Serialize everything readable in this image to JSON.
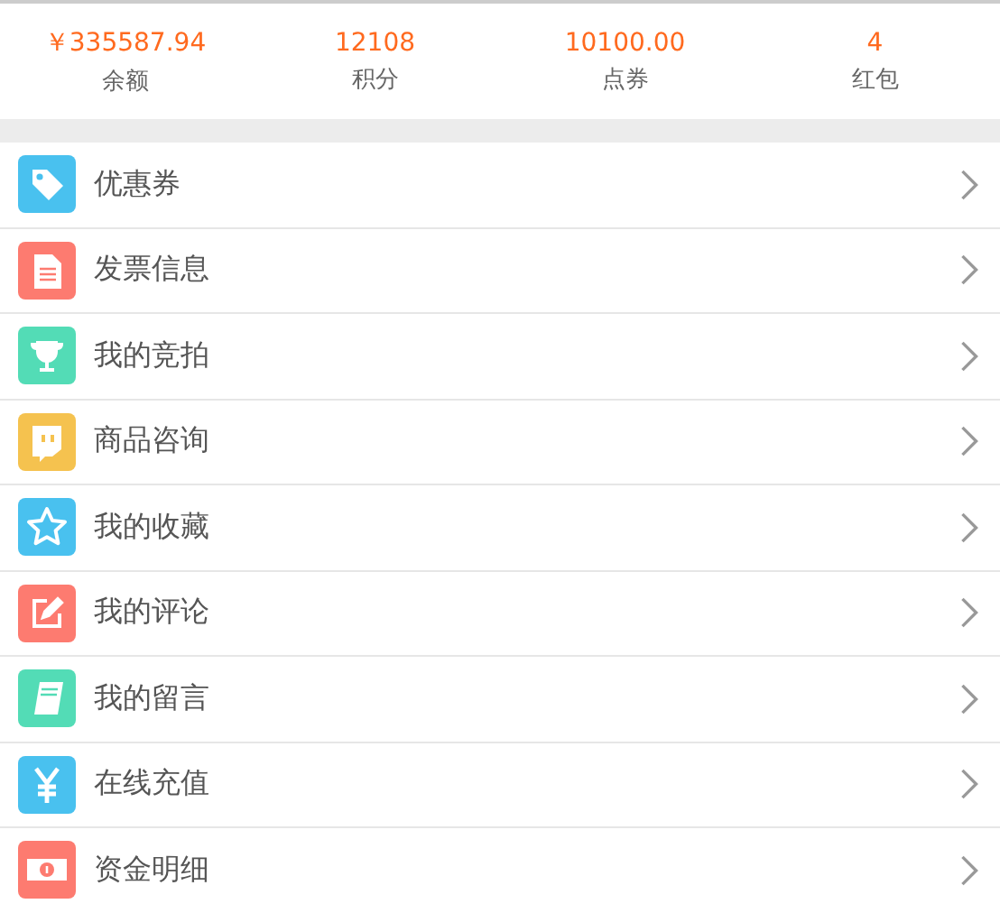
{
  "stats": [
    {
      "value": "￥335587.94",
      "label": "余额"
    },
    {
      "value": "12108",
      "label": "积分"
    },
    {
      "value": "10100.00",
      "label": "点券"
    },
    {
      "value": "4",
      "label": "红包"
    }
  ],
  "menu": [
    {
      "label": "优惠券",
      "kind": "tag",
      "color": "#49c1ef"
    },
    {
      "label": "发票信息",
      "kind": "document",
      "color": "#fd7b70"
    },
    {
      "label": "我的竞拍",
      "kind": "trophy",
      "color": "#53dcb6"
    },
    {
      "label": "商品咨询",
      "kind": "chat",
      "color": "#f5c24f"
    },
    {
      "label": "我的收藏",
      "kind": "star",
      "color": "#49c1ef"
    },
    {
      "label": "我的评论",
      "kind": "edit",
      "color": "#fd7b70"
    },
    {
      "label": "我的留言",
      "kind": "book",
      "color": "#53dcb6"
    },
    {
      "label": "在线充值",
      "kind": "yen",
      "color": "#49c1ef"
    },
    {
      "label": "资金明细",
      "kind": "money",
      "color": "#fd7b70"
    }
  ]
}
